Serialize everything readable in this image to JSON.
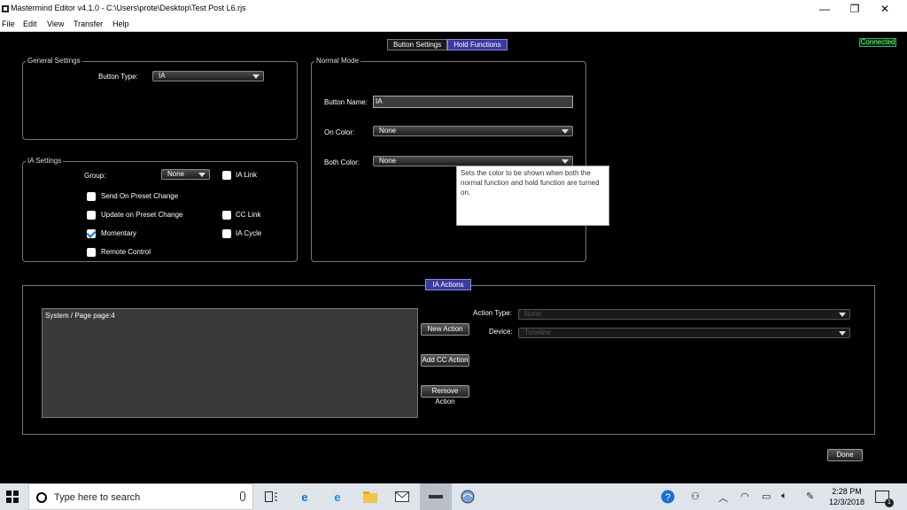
{
  "titlebar": {
    "title": "Mastermind Editor v4.1.0 - C:\\Users\\prote\\Desktop\\Test Post L6.rjs",
    "minimize": "—",
    "restore": "❐",
    "close": "✕"
  },
  "menu": [
    "File",
    "Edit",
    "View",
    "Transfer",
    "Help"
  ],
  "tabs": [
    "Button Settings",
    "Hold Functions"
  ],
  "status": "Connected",
  "general": {
    "legend": "General Settings",
    "button_type_label": "Button Type:",
    "button_type_value": "IA"
  },
  "ia_settings": {
    "legend": "IA Settings",
    "group_label": "Group:",
    "group_value": "None",
    "checkboxes": [
      {
        "label": "IA Link",
        "checked": false
      },
      {
        "label": "Send On Preset Change",
        "checked": false
      },
      {
        "label": "Update on Preset Change",
        "checked": false
      },
      {
        "label": "CC Link",
        "checked": false
      },
      {
        "label": "Momentary",
        "checked": true
      },
      {
        "label": "IA Cycle",
        "checked": false
      },
      {
        "label": "Remote Control",
        "checked": false
      }
    ]
  },
  "normal_mode": {
    "legend": "Normal Mode",
    "button_name_label": "Button Name:",
    "button_name_value": "IA",
    "on_color_label": "On Color:",
    "on_color_value": "None",
    "both_color_label": "Both Color:",
    "both_color_value": "None"
  },
  "tooltip": "Sets the color to be shown when both the normal function and hold function are turned on.",
  "ia_actions": {
    "tab": "IA Actions",
    "list_items": [
      "System / Page page:4"
    ],
    "buttons": [
      "New Action",
      "Add CC Action",
      "Remove Action"
    ],
    "action_type_label": "Action Type:",
    "action_type_value": "None",
    "device_label": "Device:",
    "device_value": "Timeline"
  },
  "done": "Done",
  "taskbar": {
    "search_placeholder": "Type here to search",
    "time": "2:28 PM",
    "date": "12/3/2018",
    "notification_count": "1"
  }
}
